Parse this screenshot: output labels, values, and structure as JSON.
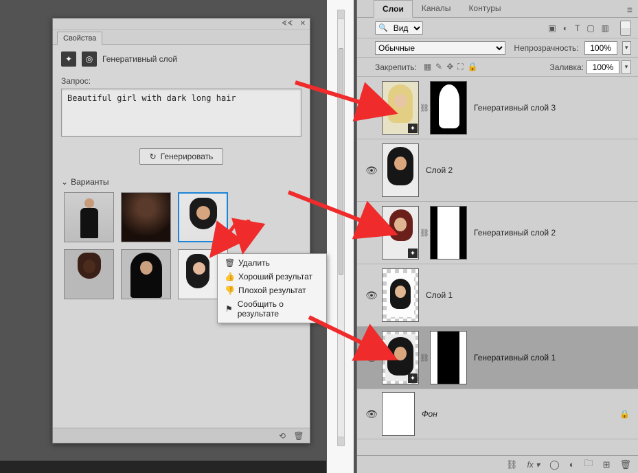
{
  "props": {
    "tab": "Свойства",
    "sectionTitle": "Генеративный слой",
    "promptLabel": "Запрос:",
    "promptValue": "Beautiful girl with dark long hair",
    "generateBtn": "Генерировать",
    "variantsTitle": "Варианты"
  },
  "context": {
    "delete": "Удалить",
    "good": "Хороший результат",
    "bad": "Плохой результат",
    "report": "Сообщить о результате"
  },
  "layers": {
    "tabs": {
      "layers": "Слои",
      "channels": "Каналы",
      "paths": "Контуры"
    },
    "searchType": "Вид",
    "blendMode": "Обычные",
    "opacityLabel": "Непрозрачность:",
    "opacityValue": "100%",
    "lockLabel": "Закрепить:",
    "fillLabel": "Заливка:",
    "fillValue": "100%",
    "names": {
      "gen3": "Генеративный слой 3",
      "l2": "Слой 2",
      "gen2": "Генеративный слой 2",
      "l1": "Слой 1",
      "gen1": "Генеративный слой 1",
      "bg": "Фон"
    }
  }
}
